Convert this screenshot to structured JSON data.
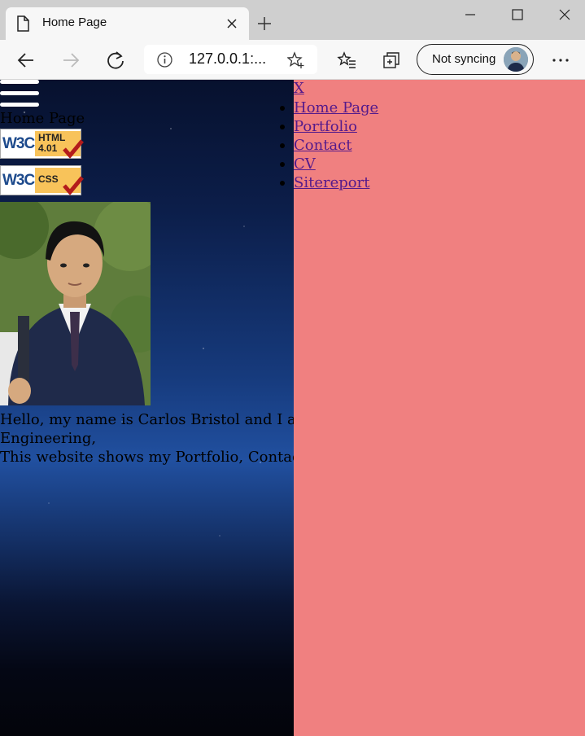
{
  "browser": {
    "tab_title": "Home Page",
    "address": "127.0.0.1:...",
    "sync_label": "Not syncing"
  },
  "page": {
    "site_title": "Home Page",
    "badges": [
      {
        "logo": "W3C",
        "label": "HTML\n4.01"
      },
      {
        "logo": "W3C",
        "label": "CSS"
      }
    ],
    "intro_line1": "Hello, my name is Carlos Bristol and I am a fi",
    "intro_line2": "Engineering,",
    "intro_line3": "This website shows my Portfolio, Contact, CV"
  },
  "sidenav": {
    "close_label": "X",
    "items": [
      {
        "label": "Home Page"
      },
      {
        "label": "Portfolio"
      },
      {
        "label": "Contact"
      },
      {
        "label": "CV"
      },
      {
        "label": "Sitereport"
      }
    ]
  },
  "colors": {
    "sidenav_bg": "#f08080",
    "link": "#551a8b"
  }
}
